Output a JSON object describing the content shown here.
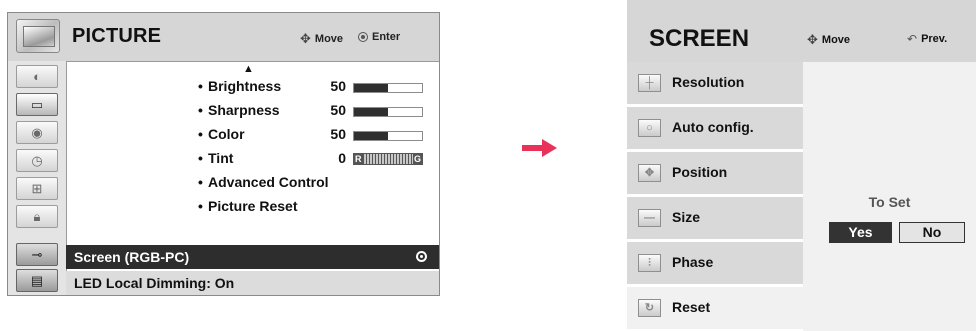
{
  "picture_menu": {
    "title": "PICTURE",
    "hint_move": "Move",
    "hint_enter": "Enter",
    "sidebar_icons": [
      "picture-icon",
      "monitor-icon",
      "audio-icon",
      "time-icon",
      "option-icon",
      "lock-icon",
      "input-icon",
      "usb-icon"
    ],
    "items": [
      {
        "bullet": "•",
        "label": "Brightness",
        "value": "50",
        "level": 0.5
      },
      {
        "bullet": "•",
        "label": "Sharpness",
        "value": "50",
        "level": 0.5
      },
      {
        "bullet": "•",
        "label": "Color",
        "value": "50",
        "level": 0.5
      },
      {
        "bullet": "•",
        "label": "Tint",
        "value": "0",
        "tint_left": "R",
        "tint_right": "G"
      },
      {
        "bullet": "•",
        "label": "Advanced Control"
      },
      {
        "bullet": "•",
        "label": "Picture Reset"
      }
    ],
    "selected_item": "Screen (RGB-PC)",
    "led_item": "LED Local Dimming: On"
  },
  "screen_menu": {
    "title": "SCREEN",
    "hint_move": "Move",
    "hint_prev": "Prev.",
    "items": [
      "Resolution",
      "Auto config.",
      "Position",
      "Size",
      "Phase",
      "Reset"
    ],
    "confirm_text": "To Set",
    "yes_label": "Yes",
    "no_label": "No"
  },
  "colors": {
    "selected_row": "#2d2d2d",
    "arrow": "#e8325a",
    "panel_gray": "#d9d9d9"
  }
}
